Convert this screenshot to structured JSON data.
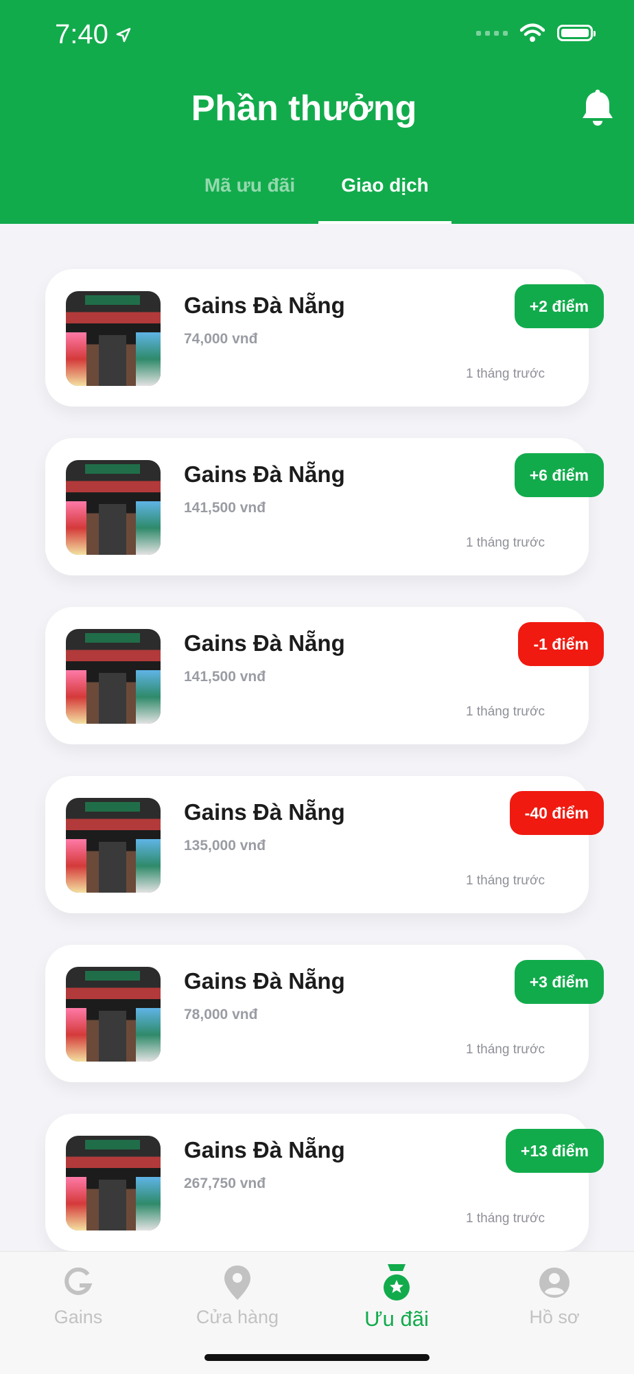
{
  "status_bar": {
    "time": "7:40"
  },
  "header": {
    "title": "Phần thưởng"
  },
  "tabs": [
    {
      "label": "Mã ưu đãi",
      "active": false
    },
    {
      "label": "Giao dịch",
      "active": true
    }
  ],
  "transactions": [
    {
      "shop": "Gains Đà Nẵng",
      "amount": "74,000 vnđ",
      "time": "1 tháng trước",
      "points": "+2 điểm",
      "type": "plus"
    },
    {
      "shop": "Gains Đà Nẵng",
      "amount": "141,500 vnđ",
      "time": "1 tháng trước",
      "points": "+6 điểm",
      "type": "plus"
    },
    {
      "shop": "Gains Đà Nẵng",
      "amount": "141,500 vnđ",
      "time": "1 tháng trước",
      "points": "-1 điểm",
      "type": "minus"
    },
    {
      "shop": "Gains Đà Nẵng",
      "amount": "135,000 vnđ",
      "time": "1 tháng trước",
      "points": "-40 điểm",
      "type": "minus"
    },
    {
      "shop": "Gains Đà Nẵng",
      "amount": "78,000 vnđ",
      "time": "1 tháng trước",
      "points": "+3 điểm",
      "type": "plus"
    },
    {
      "shop": "Gains Đà Nẵng",
      "amount": "267,750 vnđ",
      "time": "1 tháng trước",
      "points": "+13 điểm",
      "type": "plus"
    }
  ],
  "bottom_nav": [
    {
      "label": "Gains",
      "icon": "gains-logo-icon",
      "active": false
    },
    {
      "label": "Cửa hàng",
      "icon": "map-pin-icon",
      "active": false
    },
    {
      "label": "Ưu đãi",
      "icon": "medal-star-icon",
      "active": true
    },
    {
      "label": "Hồ sơ",
      "icon": "user-circle-icon",
      "active": false
    }
  ],
  "colors": {
    "brand_green": "#12ab4c",
    "minus_red": "#f01a10",
    "text_gray": "#9a9ca3"
  }
}
